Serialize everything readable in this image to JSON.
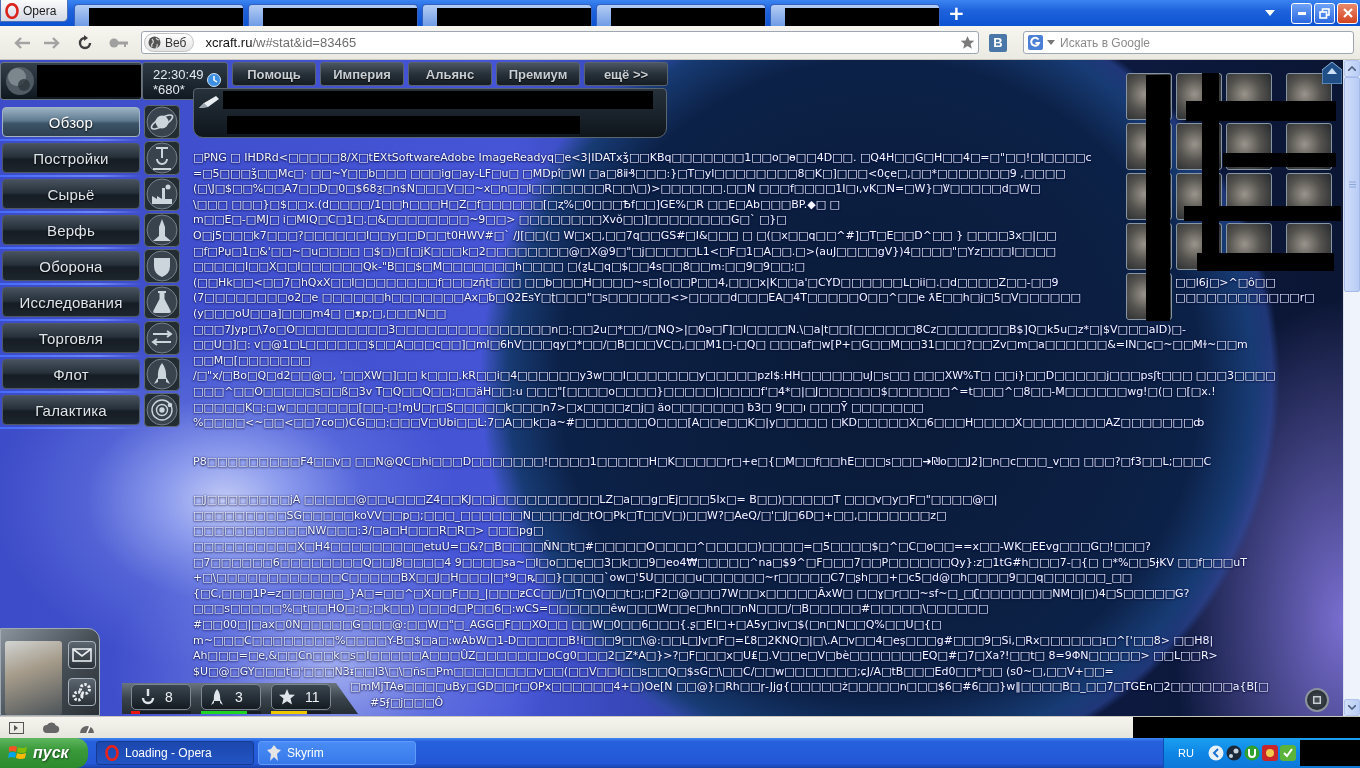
{
  "browser": {
    "menu_button": "Opera",
    "tabs": [
      {
        "redacted": true
      },
      {
        "redacted": true
      },
      {
        "redacted": true
      },
      {
        "redacted": true
      },
      {
        "redacted": true
      }
    ],
    "new_tab": "+",
    "address": {
      "badge": "Веб",
      "domain": "xcraft.ru",
      "path": "/w#stat&id=83465"
    },
    "vk_button": "В",
    "search": {
      "placeholder": "Искать в Google"
    }
  },
  "game": {
    "clock": {
      "time": "22:30:49",
      "subtext": "*680*"
    },
    "nav_tabs": [
      {
        "label": "Помощь"
      },
      {
        "label": "Империя"
      },
      {
        "label": "Альянс"
      },
      {
        "label": "Премиум"
      },
      {
        "label": "ещё >>"
      }
    ],
    "menu": [
      {
        "label": "Обзор",
        "selected": true
      },
      {
        "label": "Постройки",
        "selected": false
      },
      {
        "label": "Сырьё",
        "selected": false
      },
      {
        "label": "Верфь",
        "selected": false
      },
      {
        "label": "Оборона",
        "selected": false
      },
      {
        "label": "Исследования",
        "selected": false
      },
      {
        "label": "Торговля",
        "selected": false
      },
      {
        "label": "Флот",
        "selected": false
      },
      {
        "label": "Галактика",
        "selected": false
      }
    ],
    "text_dump": {
      "paragraphs": [
        {
          "lines": [
            {
              "text": "□PNG □ IHDRd<□□□□□8/X□tEXtSoftwareAdobe ImageReadyq□e<3|IDATxǯ□□KBq□□□□□□□1□□o□ɵ□□4D□□. □Q4H□□G□H□□4□=□\"□□!□I□□□□c"
            },
            {
              "text": "=□5□□□ǯ□□Mc□· □□~Y□□b□□□ □□□ig□ay-LF□u□ □MDpî□WI □a□8ⅱ₰□□□:}□T□yl□□□□□□□□8□K□]□□□<0çe□,□□*□□□□□□□9 ,□□□□"
            },
            {
              "text": "(□\\J□$□□%□□A7□□D□0□$68ƺ□n$N□□□V□□~x□n□□I□□□□□□□R□□\\□)>□□□□□□.□□N □□□f□□□□1I□ı,vK□N=□W}□Ꝟ□□□□□d□W□"
            },
            {
              "text": "\\□□□ □□□}□$□□x.(d□□□□/1□□h□□□H□Z□f□□□□□□[□ʐ%□0□□□Ѣf□□]GE%□R □□E□Ab□□□BP.◆□ □"
            },
            {
              "text": "m□□E□-□MJ□ i□MIQ□C□1□.□&□□□□□□□□~9□□> □□□□□□□□Xvǒ□□]□□□□□□□□G□` □}□"
            },
            {
              "text": "O□j5□□□k7□□□?□□□□□□I□□y□□D□□t0HWV#□` /J[□□(□ W□x□,□□7q□□GS#□I&□□□ □ □(□x□□q□□^#]□T□E□□D^□□ } □□□□3x□|□□"
            },
            {
              "text": "□f□Pџ□1□&'□□~□u□□□□ □$□)□[□jK□□□k□2□□□□□□□□@□X@9□\"□j□□□□□L1<□F□1□A□□.□>(auJ□□□□gV})4□□□□\"□Yz□□□I□□□□"
            },
            {
              "text": "□□□□□I□□X□□I□□□□□□Qk-\"B□□$□M□□□□□□□h□□□□ □(ƺL□q□$□□4s□□8□□m:□□9□9□□;□"
            },
            {
              "text": "(□□Hk□□<□□7□hQxX□□I□□□□□□□□f□□□zῆt□□□ □□b□□□H□□□□~s□[o□□P□□4,□□□x|K□□a'□CYD□□□□□□L□ii□.□d□□□□Z□□-□□9",
              "after_thumbnail": "□□l6j□>^□ô□□"
            },
            {
              "text": "(7□□□□□□□□o2□e □□□□□□h□□□□□□□Ax□ƀ□Q2EsY□ʈ□□□\"□s□□□□□□<>□□□□d□□□EA□4T□□□□□O□□^□□e ƛE□□h□j□5□V□□□□□□",
              "after_thumbnail": "□□□□□□□□□□□□r□"
            },
            {
              "text": "(y□□□oU□□a]□□□m4□ □ᴥp;□,□□□N□□"
            },
            {
              "text": "□□□7Jyp□\\7o□O□□□□□□□□□3□□□□□□□□□□□□□□□n□:□□2u□*□□/□NQ>|□0ә□Γ]□I□□□□N.\\□a|t□□[□□□□□□8Cz□□□□□□□B$]Q□k5u□z*□|$V□□□aID)□-"
            },
            {
              "text": "□□U□]□: v□@1□L□□□□□□$□□A□□□c□□]□ml□6hV□□□qy□*□□/□B□□□VC□,□□M1□-□Q□ □□□af□w[P+□G□□M□□31□□□?□□Zv□m□a□□□□□□&=IN□ɕ□~□□Mɫ~□□m"
            },
            {
              "text": "□□M□[□□□□□□□"
            },
            {
              "text": "/□\"x/□Bo□Q□d2□□@□, '□□XW□]□□ k□□□.kR□□i□4□□□□□□y3w□□I□□□□□□□y□□□□□pzI$:HH□□□□□□uJ□s□□ □□□XW%T□ □□i}□□D□□□□□j□□□psʃt□□□ □□□3□□□□"
            },
            {
              "text": "□□□^□□O□□□□□s□□ß□3v T□Q□□Q□□;□□äH□□:u □□□\"[□□□□o□□□□}□□□□□|□□□□f'□4*□|□J□□□□□□$□□□□□□^=t□□□^□8□□-M□□□□□□wg!□(□ □[□x.!"
            },
            {
              "text": "□□□□□K□:□w□□□□□□□[□□-□!ɱU□ɼ□S□□□□□k□□□n7>□x□□□□z□j□ äo□□□□□□□ ƀ3□ 9□□ı □□□Ȳ □□□□□□□"
            },
            {
              "text": "%□□□□<~□□<□□7co□)CG□□:□□□V□Ubi□□L:7□A□□k□a~#□□□□□□□O□□□[A□□e□□K□|y□□□□□ □KD□□□□□X□6□□□H□□□□X□□□□□□□□AZ□□□□□□□ȸ"
            }
          ]
        },
        {
          "lines": [
            {
              "text": "P8□□□□□□□□□F4□□v□ □□N@QC□hi□□□D□□□□□□□!□□□□1□□□□□H□K□□□□□r□+e□{□M□□f□□hE□□□s□□□➜₪o□□J2]□n□c□□□_v□□ □□□?□f3□□L;□□□C"
            }
          ]
        },
        {
          "lines": [
            {
              "text": "□J□□□□□□□□jA □□□□□@□□u□□□Z4□□KJ□□j□□□□□□□□□□LZ□a□□g□Ej□□□5lx□= B□□)□□□□□T □□□v□y□F□\"□□□□@□|"
            },
            {
              "text": "□□□□□□□□□SG□□□□□koVV□□p□;□□□_□□□□□□N□□□□d□tO□Pk□T□□V□)□□W?□AeQ/□'□J□6D□+□□,□□□□□□□z□"
            },
            {
              "text": "□□□□□□□□□□□NW□□□:3/□a□H□□□R□R□> □□□pg□"
            },
            {
              "text": "□□□□□□□□□□X□H4□□□□□□□□□etuU=□&?□B□□□□ÑN□t□#□□□□□O□□□□^□□□□□)□□□□=□5□□□□$□^□C□o□□==x□□-WK□EEvg□□□G□!□□□?"
            },
            {
              "text": "□7□□□□□□6□□□□□□□□Q□□J8□□□□4 9□□□□sa~□I□o□□ę□□3□k□□9□eo4₩□□□□□^na□$9^□F□□□7□□P□□□□□□Qy}:z□1tG#h□□□7-□{□ □*%□□5ɉKV □□f□□□uT"
            },
            {
              "text": "+□\\□□□□□□□□□□□□C□□□□□BX□□J□H□□□|□*9□ꝶ□□}□□□□`ow□'5U□□□□u□□□□□□~r□□□□□C7□ʂh□□+□c5□d@□h□□□□9□□q□□□□□□_□□"
            },
            {
              "text": "{□C,□□□1P=z□□□□□□_}A□=□□^□X□□F□□_|□□□ƶCC□□/□T□\\Q□□t□;□F2□@□□□7W□□x□□□□□ÃxW□ □□ɣ□r□□~sf~□_□ʗ□□□□□□□NM□|□)4□S□□□□□G?"
            },
            {
              "text": "□□□s□□□□□%□t□□HO□:□;□k□□) □□□d□P□□6□:wCS=□□□□□□êw□□□W□□e□hn□□nN□□□/□B□□□□□#□□□□□\\□□□□□□"
            },
            {
              "text": "#□□00□|□ax□0N□□□□□G□□□@:□□W□\"□_AGG□F□□XO□□ □□W□0□□6□□□{.ʂ□EI□+□A5y□iv□$(□n□N□□Q%□□U□{□"
            },
            {
              "text": "m~□□□C□□□□□□□□%□□□□Y-B□$□a□:wAbW□1-D□□□□□B!i□□□9□□\\@:□□L□Jv□F□=Ľ8□2KNQ□|□\\.A□v□□4□eş□□□g#□□□9□Si,□Rx□□□□□□ɪ□^['□□8> □□H8|"
            },
            {
              "text": "Ah□□□=□e,&□□Cn□□k□s□I□□□□□A□□□ÛZ□□□□□□□oCg0□□□2□Z*A□}>?□F□□□x□U₤□.V□□e□V□bè□□□□□□□EQ□#□7□Xa?!□□t□ 8=9ΦN□□□□□> □□L□□R>"
            },
            {
              "text": "$U□@□GY□□□t□'□□□N3ᵻ□□l3\\□\\□ñs□Pm□□□□□□□□v□□(□□V□□I□□s□□Q□$sG□\\□□C/□□w□□□□□□□;ɕJ/A□tB□□□Ed0□□*□□ (s0~□,□□V+□□="
            }
          ]
        }
      ],
      "lines_beside_stats": [
        {
          "text": "□mMjTAɵ□□□□uBy□GD□□r□OPx□□□□□□4+□)Oe[N □□@}□Rh□□ɼ-Jjg{□□□□□ż□□□□□n□□□$6□#6□□}w‖□□□□B□_□□7□TGEn□2□□□□□□a{B[□"
        },
        {
          "text": "#5ʄ□j□□□Ô"
        }
      ]
    },
    "stats": [
      {
        "value": "8",
        "color": "#e8160c",
        "level": 0.15
      },
      {
        "value": "3",
        "color": "#22d422",
        "level": 0.77
      },
      {
        "value": "11",
        "color": "#f0c800",
        "level": 0.6
      }
    ]
  },
  "taskbar": {
    "start": "пуск",
    "tasks": [
      {
        "label": "Loading - Opera",
        "selected": true
      },
      {
        "label": "Skyrim",
        "selected": false
      }
    ],
    "language": "RU"
  }
}
